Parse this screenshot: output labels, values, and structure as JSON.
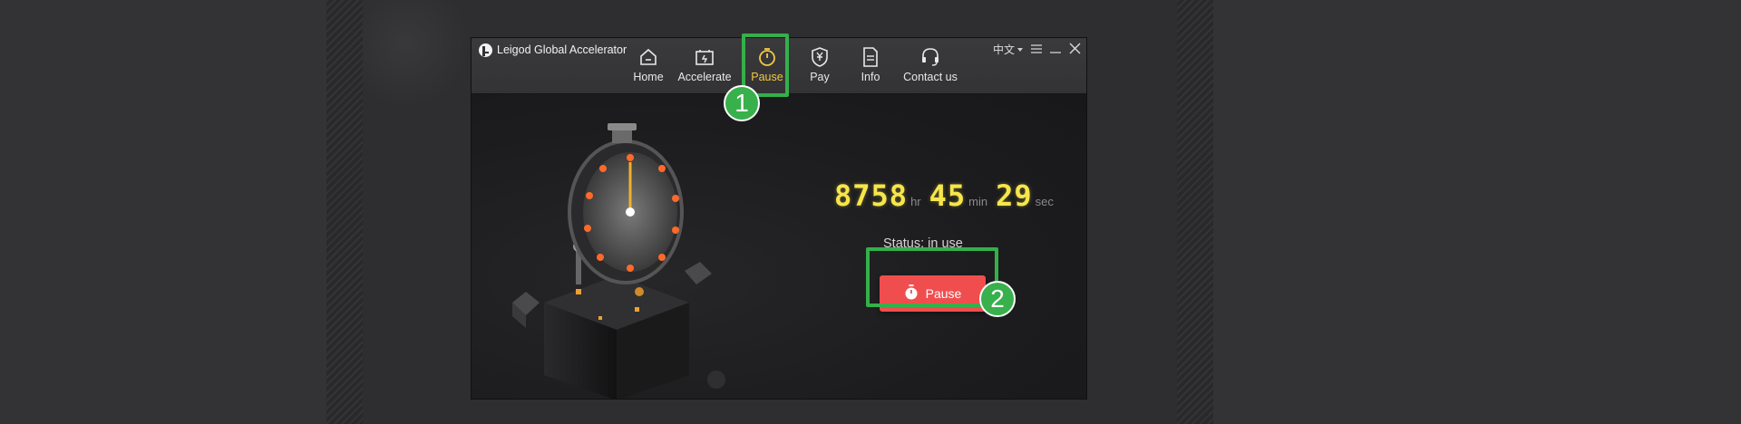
{
  "app": {
    "title": "Leigod Global Accelerator"
  },
  "nav": {
    "items": [
      {
        "label": "Home",
        "icon": "home-icon"
      },
      {
        "label": "Accelerate",
        "icon": "accelerate-icon"
      },
      {
        "label": "Pause",
        "icon": "stopwatch-icon",
        "active": true
      },
      {
        "label": "Pay",
        "icon": "yen-shield-icon"
      },
      {
        "label": "Info",
        "icon": "document-icon"
      },
      {
        "label": "Contact us",
        "icon": "headset-icon"
      }
    ]
  },
  "window_controls": {
    "language": "中文"
  },
  "timer": {
    "hours": "8758",
    "hours_unit": "hr",
    "minutes": "45",
    "minutes_unit": "min",
    "seconds": "29",
    "seconds_unit": "sec"
  },
  "status": {
    "text": "Status: in use"
  },
  "pause_button": {
    "label": "Pause"
  },
  "annotations": {
    "badge_1": "1",
    "badge_2": "2"
  },
  "colors": {
    "accent_yellow": "#f4c842",
    "timer_digits": "#f7e64a",
    "pause_button": "#f04e4e",
    "highlight_green": "#34b04a"
  }
}
